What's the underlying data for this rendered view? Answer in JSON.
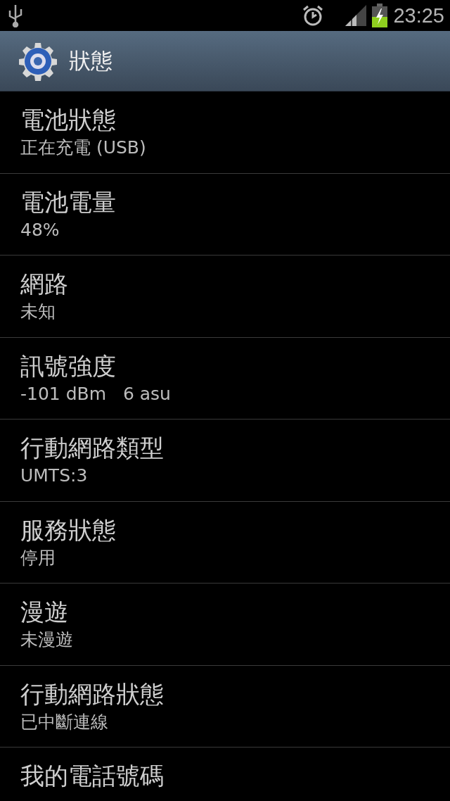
{
  "status_bar": {
    "time": "23:25"
  },
  "header": {
    "title": "狀態"
  },
  "items": [
    {
      "title": "電池狀態",
      "summary": "正在充電 (USB)"
    },
    {
      "title": "電池電量",
      "summary": "48%"
    },
    {
      "title": "網路",
      "summary": "未知"
    },
    {
      "title": "訊號強度",
      "summary": "-101 dBm   6 asu"
    },
    {
      "title": "行動網路類型",
      "summary": "UMTS:3"
    },
    {
      "title": "服務狀態",
      "summary": "停用"
    },
    {
      "title": "漫遊",
      "summary": "未漫遊"
    },
    {
      "title": "行動網路狀態",
      "summary": "已中斷連線"
    },
    {
      "title": "我的電話號碼"
    }
  ]
}
